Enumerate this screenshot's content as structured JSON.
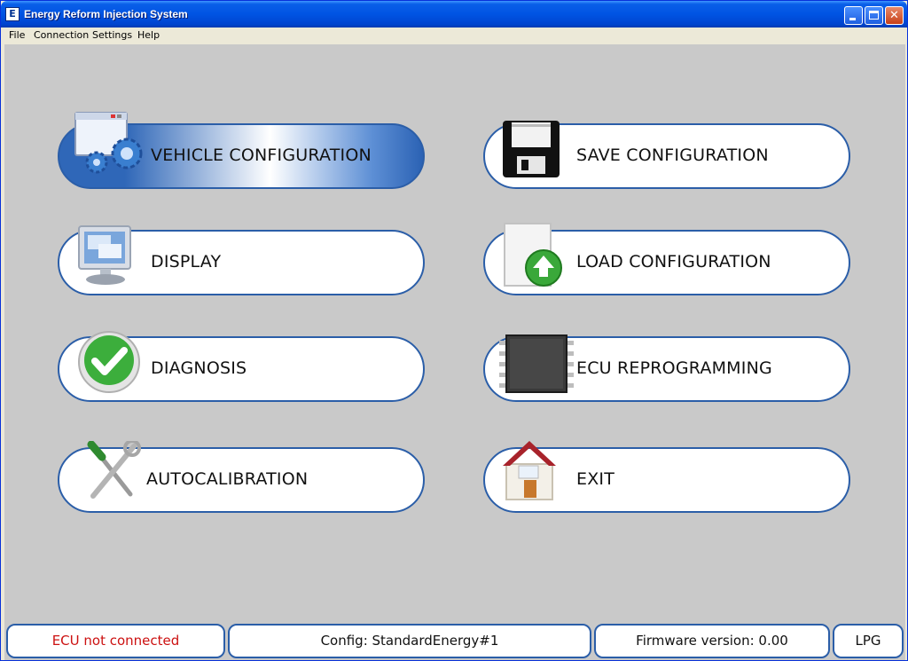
{
  "window": {
    "title": "Energy Reform Injection System",
    "icon_letter": "E"
  },
  "menu": [
    "File",
    "Connection",
    "Settings",
    "Help"
  ],
  "buttons": {
    "vehicle_configuration": {
      "label": "VEHICLE CONFIGURATION",
      "icon": "settings-window-icon",
      "selected": true
    },
    "save_configuration": {
      "label": "SAVE CONFIGURATION",
      "icon": "floppy-disk-icon"
    },
    "display": {
      "label": "DISPLAY",
      "icon": "monitor-icon"
    },
    "load_configuration": {
      "label": "LOAD CONFIGURATION",
      "icon": "upload-document-icon"
    },
    "diagnosis": {
      "label": "DIAGNOSIS",
      "icon": "checkmark-icon"
    },
    "ecu_reprogramming": {
      "label": "ECU REPROGRAMMING",
      "icon": "chip-icon"
    },
    "autocalibration": {
      "label": "AUTOCALIBRATION",
      "icon": "tools-icon"
    },
    "exit": {
      "label": "EXIT",
      "icon": "home-icon"
    }
  },
  "status": {
    "ecu": "ECU not connected",
    "config": "Config: StandardEnergy#1",
    "firmware": "Firmware version: 0.00",
    "fuel": "LPG"
  },
  "colors": {
    "accent": "#2b5ea8",
    "error_text": "#cc1111",
    "client_bg": "#c9c9c9"
  }
}
